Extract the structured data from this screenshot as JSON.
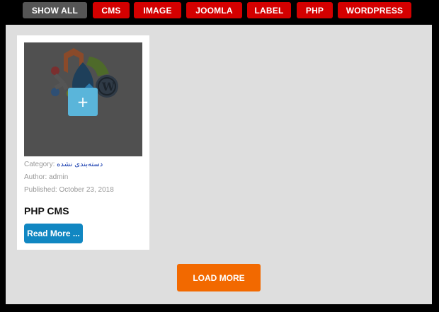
{
  "filters": [
    {
      "label": "SHOW ALL",
      "active": true
    },
    {
      "label": "CMS",
      "active": false
    },
    {
      "label": "IMAGE",
      "active": false
    },
    {
      "label": "JOOMLA",
      "active": false
    },
    {
      "label": "LABEL",
      "active": false
    },
    {
      "label": "PHP",
      "active": false
    },
    {
      "label": "WORDPRESS",
      "active": false
    }
  ],
  "colors": {
    "filter_active": "#555555",
    "filter_default": "#d40000",
    "panel_bg": "#dedede",
    "read_more": "#1187c2",
    "load_more": "#f26900",
    "category_link": "#1a3fb0"
  },
  "card": {
    "thumb_icon": "cms-logos-image",
    "overlay_icon": "plus-icon",
    "overlay_symbol": "+",
    "category_label": "Category:",
    "category_value": "دسته‌بندی نشده",
    "author_label": "Author:",
    "author_value": "admin",
    "published_label": "Published:",
    "published_value": "October 23, 2018",
    "title": "PHP CMS",
    "read_more": "Read More ..."
  },
  "load_more": "LOAD MORE"
}
